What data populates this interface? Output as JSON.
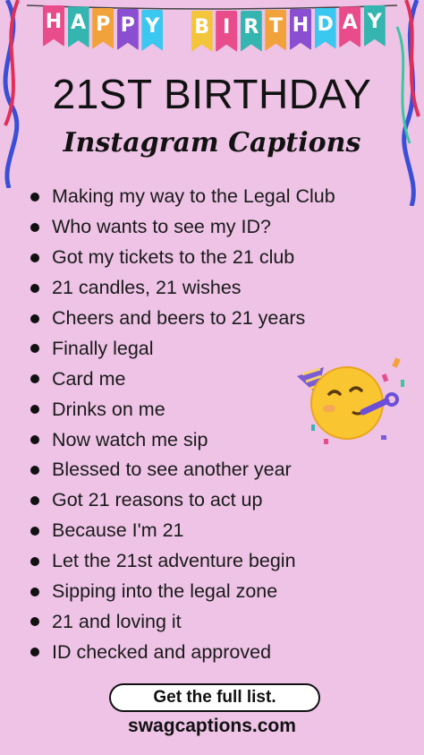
{
  "banner": {
    "letters": [
      "H",
      "A",
      "P",
      "P",
      "Y",
      "",
      "B",
      "I",
      "R",
      "T",
      "H",
      "D",
      "A",
      "Y"
    ],
    "colors": [
      "#e84c8b",
      "#35b5b0",
      "#f2a23a",
      "#8a4fd0",
      "#3ac7f0",
      "",
      "#f2c53a",
      "#e84c8b",
      "#35b5b0",
      "#f2a23a",
      "#8a4fd0",
      "#3ac7f0",
      "#e84c8b",
      "#35b5b0"
    ]
  },
  "title": "21ST BIRTHDAY",
  "subtitle": "Instagram Captions",
  "captions": [
    "Making my way to the Legal Club",
    "Who wants to see my ID?",
    "Got my tickets to the 21 club",
    "21 candles, 21 wishes",
    "Cheers and beers to 21 years",
    "Finally legal",
    "Card me",
    "Drinks on me",
    "Now watch me sip",
    "Blessed to see another year",
    "Got 21 reasons to act up",
    "Because I'm 21",
    "Let the 21st adventure begin",
    "Sipping into the legal zone",
    "21 and loving it",
    "ID checked and approved"
  ],
  "cta_label": "Get the full list.",
  "website": "swagcaptions.com",
  "colors": {
    "background": "#eec3e6",
    "text": "#121212"
  },
  "icons": {
    "emoji": "partying-face-icon",
    "streamer": "streamer-icon"
  }
}
